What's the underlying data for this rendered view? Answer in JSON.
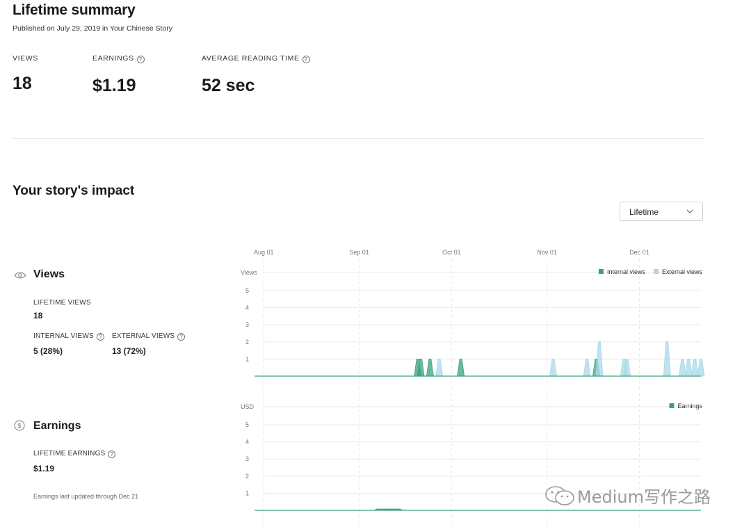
{
  "summary": {
    "title": "Lifetime summary",
    "published": "Published on July 29, 2019 in Your Chinese Story",
    "views_label": "VIEWS",
    "views_value": "18",
    "earnings_label": "EARNINGS",
    "earnings_value": "$1.19",
    "avg_label": "AVERAGE READING TIME",
    "avg_value": "52 sec",
    "help_glyph": "?"
  },
  "impact": {
    "title": "Your story's impact",
    "range_select": "Lifetime"
  },
  "views_section": {
    "title": "Views",
    "lifetime_label": "LIFETIME VIEWS",
    "lifetime_value": "18",
    "internal_label": "INTERNAL VIEWS",
    "internal_value": "5 (28%)",
    "external_label": "EXTERNAL VIEWS",
    "external_value": "13 (72%)"
  },
  "earnings_section": {
    "title": "Earnings",
    "lifetime_label": "LIFETIME EARNINGS",
    "lifetime_value": "$1.19",
    "note": "Earnings last updated through Dec 21"
  },
  "watermark": "Medium写作之路",
  "colors": {
    "internal": "#3aa37c",
    "external": "#a8d8ea",
    "earnings": "#3aa37c",
    "grid": "#e8e8e8"
  },
  "chart_data": [
    {
      "type": "area",
      "ylabel": "Views",
      "x_ticks": [
        "Aug 01",
        "Sep 01",
        "Oct 01",
        "Nov 01",
        "Dec 01"
      ],
      "y_ticks": [
        1,
        2,
        3,
        4,
        5
      ],
      "ylim": [
        0,
        5
      ],
      "x_domain": [
        "2019-07-29",
        "2019-12-21"
      ],
      "legend": "top-right",
      "series": [
        {
          "name": "Internal views",
          "color": "#3aa37c",
          "points": [
            [
              "2019-09-20",
              1
            ],
            [
              "2019-09-21",
              1
            ],
            [
              "2019-09-24",
              1
            ],
            [
              "2019-10-04",
              1
            ],
            [
              "2019-11-17",
              1
            ]
          ]
        },
        {
          "name": "External views",
          "color": "#a8d8ea",
          "points": [
            [
              "2019-09-27",
              1
            ],
            [
              "2019-11-03",
              1
            ],
            [
              "2019-11-14",
              1
            ],
            [
              "2019-11-18",
              2
            ],
            [
              "2019-11-26",
              1
            ],
            [
              "2019-11-27",
              1
            ],
            [
              "2019-12-10",
              2
            ],
            [
              "2019-12-15",
              1
            ],
            [
              "2019-12-17",
              1
            ],
            [
              "2019-12-19",
              1
            ],
            [
              "2019-12-21",
              1
            ]
          ]
        }
      ]
    },
    {
      "type": "area",
      "ylabel": "USD",
      "y_ticks": [
        1,
        2,
        3,
        4,
        5
      ],
      "ylim": [
        0,
        5
      ],
      "x_domain": [
        "2019-07-29",
        "2019-12-21"
      ],
      "legend": "top-right",
      "series": [
        {
          "name": "Earnings",
          "color": "#3aa37c",
          "points": [
            [
              "2019-09-07",
              0.08
            ],
            [
              "2019-09-08",
              0.08
            ],
            [
              "2019-09-09",
              0.08
            ],
            [
              "2019-09-10",
              0.08
            ],
            [
              "2019-09-11",
              0.08
            ],
            [
              "2019-09-12",
              0.08
            ],
            [
              "2019-09-13",
              0.08
            ],
            [
              "2019-09-14",
              0.08
            ]
          ]
        }
      ]
    }
  ]
}
